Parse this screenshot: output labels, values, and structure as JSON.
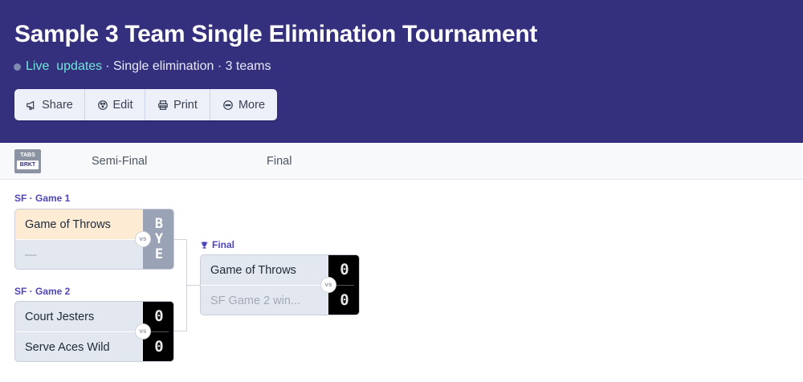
{
  "header": {
    "title": "Sample 3 Team Single Elimination Tournament",
    "live_text": "Live  updates",
    "meta_rest": "· Single elimination · 3 teams"
  },
  "toolbar": {
    "share_label": "Share",
    "edit_label": "Edit",
    "print_label": "Print",
    "more_label": "More"
  },
  "rounds": {
    "tabs_icon_top": "TABS",
    "tabs_icon_bottom": "BRKT",
    "items": [
      {
        "label": "Semi-Final"
      },
      {
        "label": "Final"
      }
    ]
  },
  "games": {
    "sf1": {
      "label": "SF · Game 1",
      "team1": "Game of Throws",
      "team2": "—",
      "bye": [
        "B",
        "Y",
        "E"
      ],
      "vs": "vs"
    },
    "sf2": {
      "label": "SF · Game 2",
      "team1": "Court Jesters",
      "team2": "Serve Aces Wild",
      "score1": "0",
      "score2": "0",
      "vs": "vs"
    },
    "final": {
      "label": "Final",
      "team1": "Game of Throws",
      "team2": "SF Game 2 win...",
      "score1": "0",
      "score2": "0",
      "vs": "vs"
    }
  },
  "colors": {
    "header_bg": "#35307e",
    "accent": "#4f46b8",
    "live": "#6ee7d8",
    "winner_highlight": "#fdebd3"
  }
}
